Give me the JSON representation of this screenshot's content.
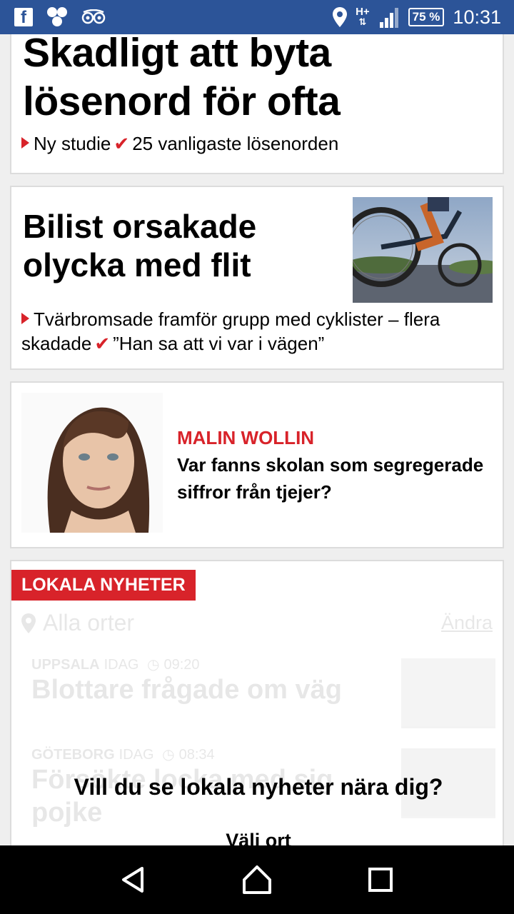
{
  "status_bar": {
    "battery": "75 %",
    "time": "10:31",
    "network": "H+",
    "icons": [
      "facebook-icon",
      "hexagon-app-icon",
      "tripadvisor-icon",
      "location-icon",
      "signal-icon",
      "battery-icon"
    ]
  },
  "articles": [
    {
      "headline": "Skadligt att byta lösenord för ofta",
      "sub_lead": "Ny studie",
      "sub_extra": "25 vanligaste lösenorden"
    },
    {
      "headline": "Bilist orsakade olycka med flit",
      "sub_lead": "Tvärbromsade framför grupp med cyklister – flera skadade",
      "sub_extra": "”Han sa att vi var i vägen”"
    }
  ],
  "opinion": {
    "author": "MALIN WOLLIN",
    "title": "Var fanns skolan som segregerade siffror från tjejer?"
  },
  "local_news": {
    "badge": "LOKALA NYHETER",
    "location": "Alla orter",
    "change_label": "Ändra",
    "items": [
      {
        "city": "UPPSALA",
        "when": "IDAG",
        "time": "09:20",
        "title": "Blottare frågade om väg"
      },
      {
        "city": "GÖTEBORG",
        "when": "IDAG",
        "time": "08:34",
        "title": "Försökte locka med sig pojke"
      }
    ],
    "prompt": "Vill du se lokala nyheter nära dig?",
    "choose_label": "Välj ort"
  },
  "colors": {
    "status_bar": "#2c5498",
    "accent_red": "#d8232a"
  }
}
